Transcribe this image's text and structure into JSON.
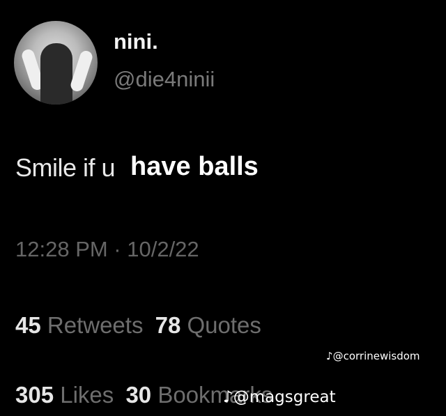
{
  "profile": {
    "name": "nini.",
    "handle": "@die4ninii"
  },
  "tweet": {
    "text_normal": "Smile if u",
    "text_bold": "have balls"
  },
  "timestamp": "12:28 PM · 10/2/22",
  "stats": {
    "retweets_count": "45",
    "retweets_label": "Retweets",
    "quotes_count": "78",
    "quotes_label": "Quotes",
    "likes_count": "305",
    "likes_label": "Likes",
    "bookmarks_count": "30",
    "bookmarks_label": "Bookmarks"
  },
  "watermarks": {
    "first": "@corrinewisdom",
    "second": "@magsgreat",
    "icon": "tiktok-icon"
  }
}
